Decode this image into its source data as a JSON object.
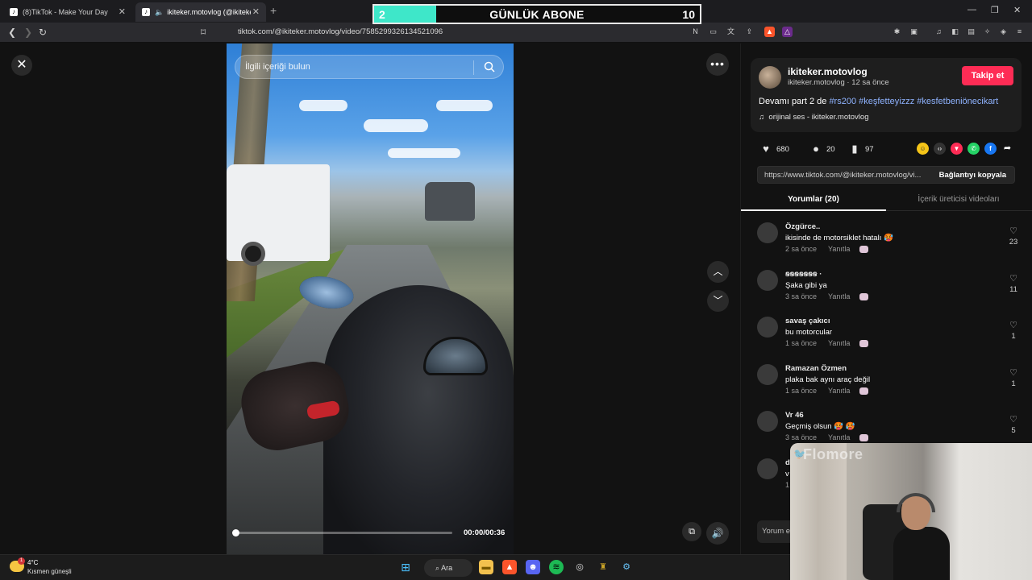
{
  "browser": {
    "tabs": [
      {
        "title": "(8)TikTok - Make Your Day"
      },
      {
        "title": "ikiteker.motovlog (@ikiteker.moto"
      }
    ],
    "url": "tiktok.com/@ikiteker.motovlog/video/7585299326134521096"
  },
  "overlay": {
    "current": "2",
    "title": "GÜNLÜK ABONE",
    "goal": "10",
    "progress": 0.19
  },
  "player": {
    "search_placeholder": "İlgili içeriği bulun",
    "time": "00:00/00:36",
    "progress": 0.0
  },
  "post": {
    "author": "ikiteker.motovlog",
    "author_sub": "ikiteker.motovlog · 12 sa önce",
    "follow_label": "Takip et",
    "description": "Devamı part 2 de ",
    "tags": "#rs200 #keşfetteyizzz #kesfetbeniönecikart",
    "music": "orijinal ses - ikiteker.motovlog",
    "likes": "680",
    "comments": "20",
    "saves": "97",
    "link": "https://www.tiktok.com/@ikiteker.motovlog/vi...",
    "copy_label": "Bağlantıyı kopyala"
  },
  "panel_tabs": [
    {
      "label": "Yorumlar (20)"
    },
    {
      "label": "İçerik üreticisi videoları"
    }
  ],
  "comments": [
    {
      "user": "Özgürce..",
      "text": "ikisinde de motorsiklet hatalı 🥵",
      "time": "2 sa önce",
      "reply": "Yanıtla",
      "likes": "23"
    },
    {
      "user": "ꞩꞩꞩꞩꞩꞩꞩ ·",
      "text": "Şaka gibi ya",
      "time": "3 sa önce",
      "reply": "Yanıtla",
      "likes": "11"
    },
    {
      "user": "savaş çakıcı",
      "text": "bu motorcular",
      "time": "1 sa önce",
      "reply": "Yanıtla",
      "likes": "1"
    },
    {
      "user": "Ramazan Özmen",
      "text": "plaka bak aynı araç değil",
      "time": "1 sa önce",
      "reply": "Yanıtla",
      "likes": "1"
    },
    {
      "user": "Vr 46",
      "text": "Geçmiş olsun 🥵 🥵",
      "time": "3 sa önce",
      "reply": "Yanıtla",
      "likes": "5"
    },
    {
      "user": "d",
      "text": "v",
      "time": "1",
      "reply": "",
      "likes": ""
    }
  ],
  "comment_input_placeholder": "Yorum e",
  "webcam": {
    "brand": "Flomore"
  },
  "taskbar": {
    "temperature": "4°C",
    "condition": "Kısmen güneşli",
    "search_label": "Ara"
  },
  "colors": {
    "accent": "#fe2c55",
    "overlay_bar": "#3ee7c9",
    "tag": "#8fb3ff"
  }
}
